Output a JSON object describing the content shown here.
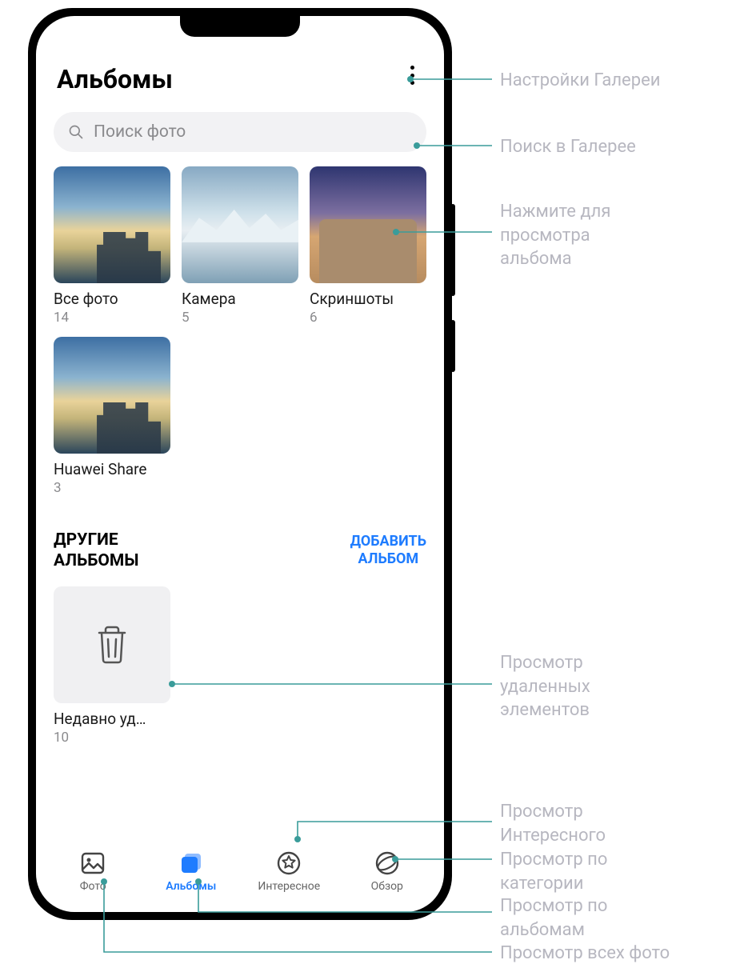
{
  "header": {
    "title": "Альбомы"
  },
  "search": {
    "placeholder": "Поиск фото"
  },
  "albums": [
    {
      "name": "Все фото",
      "count": "14",
      "thumb": "sky-city"
    },
    {
      "name": "Камера",
      "count": "5",
      "thumb": "mountain"
    },
    {
      "name": "Скриншоты",
      "count": "6",
      "thumb": "colosseum"
    },
    {
      "name": "Huawei Share",
      "count": "3",
      "thumb": "sky-city"
    }
  ],
  "other_section": {
    "title": "ДРУГИЕ\nАЛЬБОМЫ",
    "add_label": "ДОБАВИТЬ\nАЛЬБОМ",
    "trash": {
      "name": "Недавно уд…",
      "count": "10"
    }
  },
  "nav": {
    "photos": "Фото",
    "albums": "Альбомы",
    "moments": "Интересное",
    "discover": "Обзор"
  },
  "callouts": {
    "settings": "Настройки Галереи",
    "search": "Поиск в Галерее",
    "album_tap": "Нажмите для\nпросмотра\nальбома",
    "trash": "Просмотр\nудаленных\nэлементов",
    "moments": "Просмотр\nИнтересного",
    "categories": "Просмотр по\nкатегории",
    "by_albums": "Просмотр по\nальбомам",
    "all_photos": "Просмотр всех фото"
  }
}
